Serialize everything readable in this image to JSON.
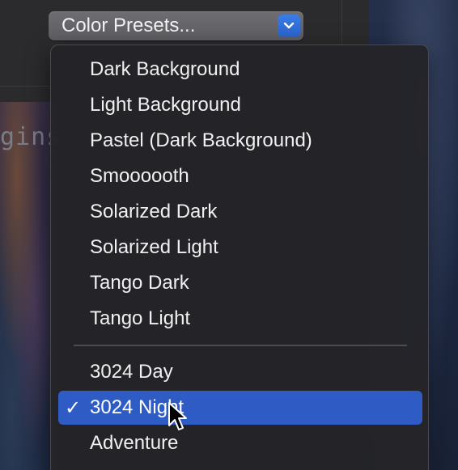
{
  "background": {
    "code_fragment": "gins"
  },
  "popup": {
    "label": "Color Presets...",
    "arrow_icon": "chevron-down-icon",
    "arrow_color": "#2f6fe0"
  },
  "menu": {
    "group1": [
      {
        "label": "Dark Background"
      },
      {
        "label": "Light Background"
      },
      {
        "label": "Pastel (Dark Background)"
      },
      {
        "label": "Smoooooth"
      },
      {
        "label": "Solarized Dark"
      },
      {
        "label": "Solarized Light"
      },
      {
        "label": "Tango Dark"
      },
      {
        "label": "Tango Light"
      }
    ],
    "group2": [
      {
        "label": "3024 Day"
      },
      {
        "label": "3024 Night",
        "selected": true,
        "check": "✓"
      },
      {
        "label": "Adventure"
      }
    ],
    "highlight_color": "#2f5bc4"
  }
}
